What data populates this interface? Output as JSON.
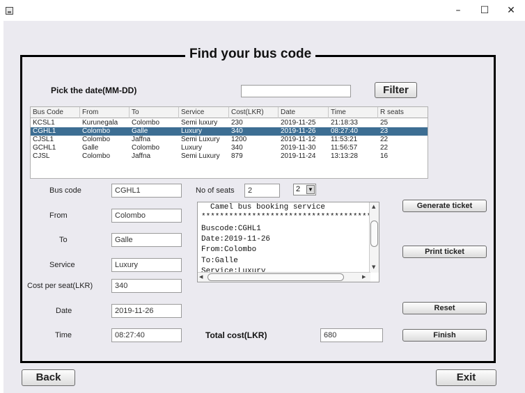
{
  "window": {
    "minimize": "–",
    "maximize": "☐",
    "close": "✕"
  },
  "title": "Find your bus code",
  "filter": {
    "label": "Pick the date(MM-DD)",
    "value": "",
    "button": "Filter"
  },
  "table": {
    "headers": [
      "Bus Code",
      "From",
      "To",
      "Service",
      "Cost(LKR)",
      "Date",
      "Time",
      "R seats"
    ],
    "rows": [
      [
        "KCSL1",
        "Kurunegala",
        "Colombo",
        "Semi luxury",
        "230",
        "2019-11-25",
        "21:18:33",
        "25"
      ],
      [
        "CGHL1",
        "Colombo",
        "Galle",
        "Luxury",
        "340",
        "2019-11-26",
        "08:27:40",
        "23"
      ],
      [
        "CJSL1",
        "Colombo",
        "Jaffna",
        "Semi Luxury",
        "1200",
        "2019-11-12",
        "11:53:21",
        "22"
      ],
      [
        "GCHL1",
        "Galle",
        "Colombo",
        "Luxury",
        "340",
        "2019-11-30",
        "11:56:57",
        "22"
      ],
      [
        "CJSL",
        "Colombo",
        "Jaffna",
        "Semi Luxury",
        "879",
        "2019-11-24",
        "13:13:28",
        "16"
      ]
    ],
    "selected_row": 1
  },
  "details": {
    "bus_code": {
      "label": "Bus code",
      "value": "CGHL1"
    },
    "from": {
      "label": "From",
      "value": "Colombo"
    },
    "to": {
      "label": "To",
      "value": "Galle"
    },
    "service": {
      "label": "Service",
      "value": "Luxury"
    },
    "cost": {
      "label": "Cost per seat(LKR)",
      "value": "340"
    },
    "date": {
      "label": "Date",
      "value": "2019-11-26"
    },
    "time": {
      "label": "Time",
      "value": "08:27:40"
    }
  },
  "seats": {
    "label": "No of seats",
    "value": "2",
    "selected": "2"
  },
  "ticket": [
    "Camel bus booking service",
    "*************************************",
    "Buscode:CGHL1",
    "Date:2019-11-26",
    "From:Colombo",
    "To:Galle",
    "Service:Luxury"
  ],
  "total": {
    "label": "Total cost(LKR)",
    "value": "680"
  },
  "buttons": {
    "generate": "Generate ticket",
    "print": "Print ticket",
    "reset": "Reset",
    "finish": "Finish",
    "back": "Back",
    "exit": "Exit"
  },
  "colors": {
    "selected_row": "#3d6e93",
    "panel_bg": "#ebeaf0"
  }
}
